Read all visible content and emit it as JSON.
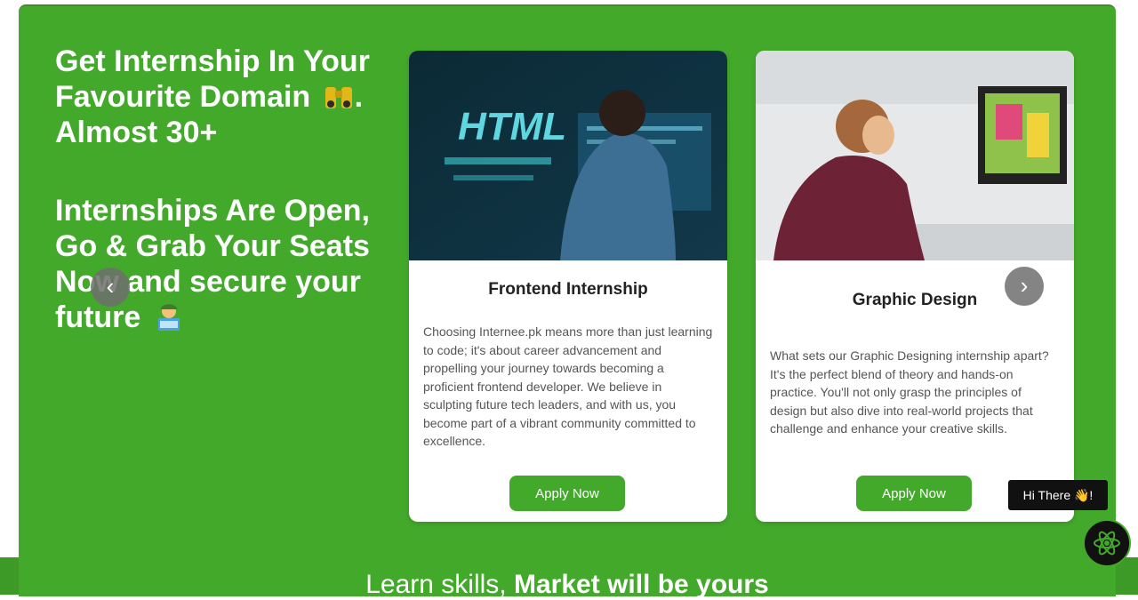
{
  "hero": {
    "headline_part1": "Get Internship In Your Favourite Domain",
    "headline_part2": ". Almost 30+",
    "headline_part3": "Internships Are Open, Go & Grab Your Seats Now and secure your future",
    "tagline_light": "Learn skills,",
    "tagline_bold": "Market will be yours"
  },
  "cards": [
    {
      "title": "Frontend Internship",
      "image_text": "HTML",
      "description": "Choosing Internee.pk means more than just learning to code; it's about career advancement and propelling your journey towards becoming a proficient frontend developer. We believe in sculpting future tech leaders, and with us, you become part of a vibrant community committed to excellence.",
      "button_label": "Apply Now"
    },
    {
      "title": "Graphic Design",
      "description": "What sets our Graphic Designing internship apart? It's the perfect blend of theory and hands-on practice. You'll not only grasp the principles of design but also dive into real-world projects that challenge and enhance your creative skills.",
      "button_label": "Apply Now"
    }
  ],
  "carousel": {
    "prev_icon": "‹",
    "next_icon": "›"
  },
  "chat": {
    "bubble_text": "Hi There 👋!",
    "icon": "react-atom-icon"
  },
  "colors": {
    "brand_green": "#43a92b",
    "dark": "#111111"
  }
}
